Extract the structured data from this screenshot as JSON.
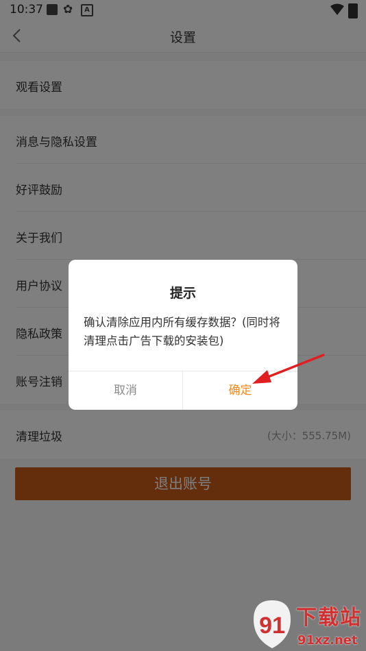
{
  "status_bar": {
    "time": "10:37"
  },
  "header": {
    "title": "设置"
  },
  "sections": {
    "watch": {
      "label": "观看设置"
    },
    "items": [
      {
        "label": "消息与隐私设置"
      },
      {
        "label": "好评鼓励"
      },
      {
        "label": "关于我们"
      },
      {
        "label": "用户协议"
      },
      {
        "label": "隐私政策"
      },
      {
        "label": "账号注销"
      }
    ],
    "clear_cache": {
      "label": "清理垃圾",
      "value": "(大小：555.75M)"
    }
  },
  "logout_label": "退出账号",
  "dialog": {
    "title": "提示",
    "message": "确认清除应用内所有缓存数据？(同时将清理点击广告下载的安装包)",
    "cancel": "取消",
    "confirm": "确定"
  },
  "watermark": {
    "top": "下载站",
    "bottom": "91xz.net"
  },
  "colors": {
    "accent": "#f28a1a",
    "logout_bg": "#c95a16",
    "arrow": "#e02020"
  }
}
